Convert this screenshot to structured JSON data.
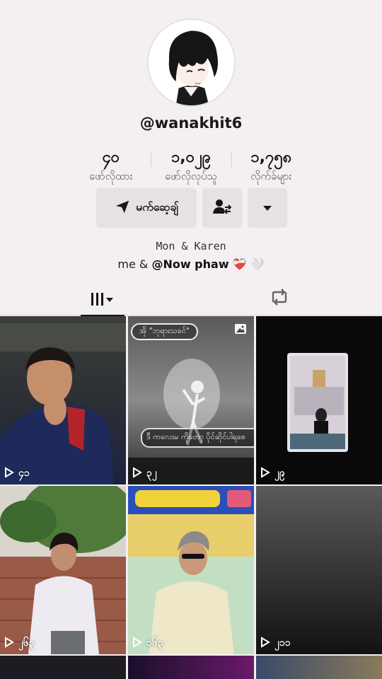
{
  "profile": {
    "username": "@wanakhit6",
    "stats": [
      {
        "value": "၄၀",
        "label": "ဖော်လိုထား"
      },
      {
        "value": "၁,၀၂၉",
        "label": "ဖော်လိုလုပ်သူ"
      },
      {
        "value": "၁,၇၅၈",
        "label": "လိုက်ခ်များ"
      }
    ],
    "message_label": "မက်ဆေ့ချ်",
    "bio_line1": "Mon & Karen",
    "bio_line2_prefix": "me & ",
    "bio_mention": "@Now phaw",
    "bio_emoji": "❤️‍🩹 🤍"
  },
  "tabs": {
    "videos_icon": "grid-icon",
    "reposts_icon": "repost-icon"
  },
  "videos": [
    {
      "views": "၄၁"
    },
    {
      "views": "၃၂",
      "tag": "အို \"ဘုရားသခင်\"",
      "caption": "ဒီ ကလေးမ ကိုတော့ ပိုင်ဆိုင်ပါရစေ"
    },
    {
      "views": "၂၉"
    },
    {
      "views": "၂၆၃"
    },
    {
      "views": "၁၆၃"
    },
    {
      "views": "၂၁၁"
    }
  ]
}
